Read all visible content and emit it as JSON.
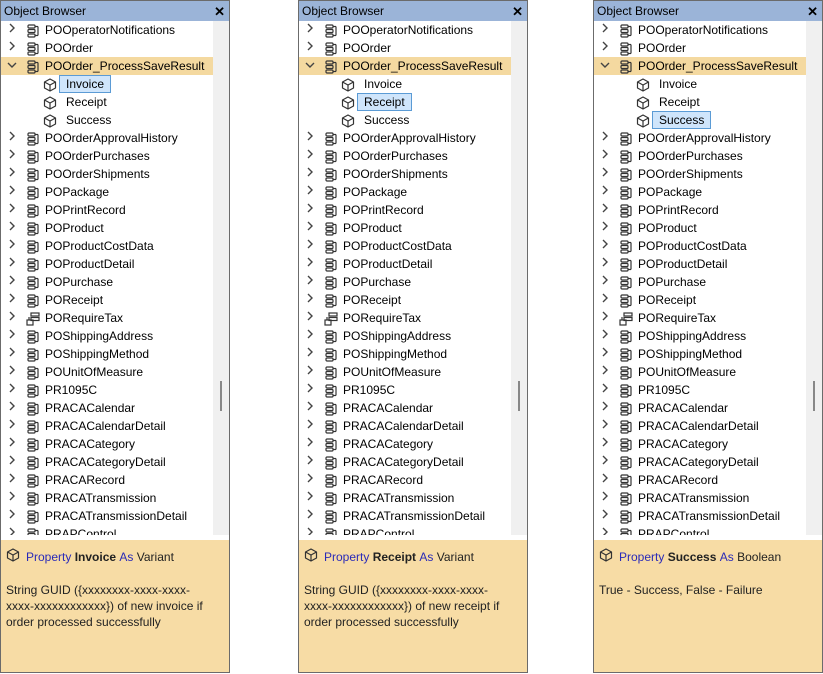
{
  "panels": [
    {
      "title": "Object Browser",
      "items": [
        {
          "type": "top",
          "label": "POOperatorNotifications",
          "icon": "table-icon",
          "chev": ">"
        },
        {
          "type": "top",
          "label": "POOrder",
          "icon": "table-icon",
          "chev": ">"
        },
        {
          "type": "top",
          "label": "POOrder_ProcessSaveResult",
          "icon": "table-icon",
          "chev": "v",
          "selected": true
        },
        {
          "type": "child",
          "label": "Invoice",
          "icon": "cube-icon",
          "hl": true
        },
        {
          "type": "child",
          "label": "Receipt",
          "icon": "cube-icon"
        },
        {
          "type": "child",
          "label": "Success",
          "icon": "cube-icon"
        },
        {
          "type": "top",
          "label": "POOrderApprovalHistory",
          "icon": "table-icon",
          "chev": ">"
        },
        {
          "type": "top",
          "label": "POOrderPurchases",
          "icon": "table-icon",
          "chev": ">"
        },
        {
          "type": "top",
          "label": "POOrderShipments",
          "icon": "table-icon",
          "chev": ">"
        },
        {
          "type": "top",
          "label": "POPackage",
          "icon": "table-icon",
          "chev": ">"
        },
        {
          "type": "top",
          "label": "POPrintRecord",
          "icon": "table-icon",
          "chev": ">"
        },
        {
          "type": "top",
          "label": "POProduct",
          "icon": "table-icon",
          "chev": ">"
        },
        {
          "type": "top",
          "label": "POProductCostData",
          "icon": "table-icon",
          "chev": ">"
        },
        {
          "type": "top",
          "label": "POProductDetail",
          "icon": "table-icon",
          "chev": ">"
        },
        {
          "type": "top",
          "label": "POPurchase",
          "icon": "table-icon",
          "chev": ">"
        },
        {
          "type": "top",
          "label": "POReceipt",
          "icon": "table-icon",
          "chev": ">"
        },
        {
          "type": "top",
          "label": "PORequireTax",
          "icon": "link-table-icon",
          "chev": ">"
        },
        {
          "type": "top",
          "label": "POShippingAddress",
          "icon": "table-icon",
          "chev": ">"
        },
        {
          "type": "top",
          "label": "POShippingMethod",
          "icon": "table-icon",
          "chev": ">"
        },
        {
          "type": "top",
          "label": "POUnitOfMeasure",
          "icon": "table-icon",
          "chev": ">"
        },
        {
          "type": "top",
          "label": "PR1095C",
          "icon": "table-icon",
          "chev": ">"
        },
        {
          "type": "top",
          "label": "PRACACalendar",
          "icon": "table-icon",
          "chev": ">"
        },
        {
          "type": "top",
          "label": "PRACACalendarDetail",
          "icon": "table-icon",
          "chev": ">"
        },
        {
          "type": "top",
          "label": "PRACACategory",
          "icon": "table-icon",
          "chev": ">"
        },
        {
          "type": "top",
          "label": "PRACACategoryDetail",
          "icon": "table-icon",
          "chev": ">"
        },
        {
          "type": "top",
          "label": "PRACARecord",
          "icon": "table-icon",
          "chev": ">"
        },
        {
          "type": "top",
          "label": "PRACATransmission",
          "icon": "table-icon",
          "chev": ">"
        },
        {
          "type": "top",
          "label": "PRACATransmissionDetail",
          "icon": "table-icon",
          "chev": ">"
        },
        {
          "type": "top",
          "label": "PRAPControl",
          "icon": "table-icon",
          "chev": ">"
        }
      ],
      "desc": {
        "kw1": "Property",
        "name": "Invoice",
        "kw2": "As",
        "type": "Variant",
        "body": "String GUID ({xxxxxxxx-xxxx-xxxx-xxxx-xxxxxxxxxxxx}) of new invoice if order processed successfully"
      }
    },
    {
      "title": "Object Browser",
      "items": [
        {
          "type": "top",
          "label": "POOperatorNotifications",
          "icon": "table-icon",
          "chev": ">"
        },
        {
          "type": "top",
          "label": "POOrder",
          "icon": "table-icon",
          "chev": ">"
        },
        {
          "type": "top",
          "label": "POOrder_ProcessSaveResult",
          "icon": "table-icon",
          "chev": "v",
          "selected": true
        },
        {
          "type": "child",
          "label": "Invoice",
          "icon": "cube-icon"
        },
        {
          "type": "child",
          "label": "Receipt",
          "icon": "cube-icon",
          "hl": true
        },
        {
          "type": "child",
          "label": "Success",
          "icon": "cube-icon"
        },
        {
          "type": "top",
          "label": "POOrderApprovalHistory",
          "icon": "table-icon",
          "chev": ">"
        },
        {
          "type": "top",
          "label": "POOrderPurchases",
          "icon": "table-icon",
          "chev": ">"
        },
        {
          "type": "top",
          "label": "POOrderShipments",
          "icon": "table-icon",
          "chev": ">"
        },
        {
          "type": "top",
          "label": "POPackage",
          "icon": "table-icon",
          "chev": ">"
        },
        {
          "type": "top",
          "label": "POPrintRecord",
          "icon": "table-icon",
          "chev": ">"
        },
        {
          "type": "top",
          "label": "POProduct",
          "icon": "table-icon",
          "chev": ">"
        },
        {
          "type": "top",
          "label": "POProductCostData",
          "icon": "table-icon",
          "chev": ">"
        },
        {
          "type": "top",
          "label": "POProductDetail",
          "icon": "table-icon",
          "chev": ">"
        },
        {
          "type": "top",
          "label": "POPurchase",
          "icon": "table-icon",
          "chev": ">"
        },
        {
          "type": "top",
          "label": "POReceipt",
          "icon": "table-icon",
          "chev": ">"
        },
        {
          "type": "top",
          "label": "PORequireTax",
          "icon": "link-table-icon",
          "chev": ">"
        },
        {
          "type": "top",
          "label": "POShippingAddress",
          "icon": "table-icon",
          "chev": ">"
        },
        {
          "type": "top",
          "label": "POShippingMethod",
          "icon": "table-icon",
          "chev": ">"
        },
        {
          "type": "top",
          "label": "POUnitOfMeasure",
          "icon": "table-icon",
          "chev": ">"
        },
        {
          "type": "top",
          "label": "PR1095C",
          "icon": "table-icon",
          "chev": ">"
        },
        {
          "type": "top",
          "label": "PRACACalendar",
          "icon": "table-icon",
          "chev": ">"
        },
        {
          "type": "top",
          "label": "PRACACalendarDetail",
          "icon": "table-icon",
          "chev": ">"
        },
        {
          "type": "top",
          "label": "PRACACategory",
          "icon": "table-icon",
          "chev": ">"
        },
        {
          "type": "top",
          "label": "PRACACategoryDetail",
          "icon": "table-icon",
          "chev": ">"
        },
        {
          "type": "top",
          "label": "PRACARecord",
          "icon": "table-icon",
          "chev": ">"
        },
        {
          "type": "top",
          "label": "PRACATransmission",
          "icon": "table-icon",
          "chev": ">"
        },
        {
          "type": "top",
          "label": "PRACATransmissionDetail",
          "icon": "table-icon",
          "chev": ">"
        },
        {
          "type": "top",
          "label": "PRAPControl",
          "icon": "table-icon",
          "chev": ">"
        }
      ],
      "desc": {
        "kw1": "Property",
        "name": "Receipt",
        "kw2": "As",
        "type": "Variant",
        "body": "String GUID ({xxxxxxxx-xxxx-xxxx-xxxx-xxxxxxxxxxxx}) of new receipt if order processed successfully"
      }
    },
    {
      "title": "Object Browser",
      "items": [
        {
          "type": "top",
          "label": "POOperatorNotifications",
          "icon": "table-icon",
          "chev": ">"
        },
        {
          "type": "top",
          "label": "POOrder",
          "icon": "table-icon",
          "chev": ">"
        },
        {
          "type": "top",
          "label": "POOrder_ProcessSaveResult",
          "icon": "table-icon",
          "chev": "v",
          "selected": true
        },
        {
          "type": "child",
          "label": "Invoice",
          "icon": "cube-icon"
        },
        {
          "type": "child",
          "label": "Receipt",
          "icon": "cube-icon"
        },
        {
          "type": "child",
          "label": "Success",
          "icon": "cube-icon",
          "hl": true
        },
        {
          "type": "top",
          "label": "POOrderApprovalHistory",
          "icon": "table-icon",
          "chev": ">"
        },
        {
          "type": "top",
          "label": "POOrderPurchases",
          "icon": "table-icon",
          "chev": ">"
        },
        {
          "type": "top",
          "label": "POOrderShipments",
          "icon": "table-icon",
          "chev": ">"
        },
        {
          "type": "top",
          "label": "POPackage",
          "icon": "table-icon",
          "chev": ">"
        },
        {
          "type": "top",
          "label": "POPrintRecord",
          "icon": "table-icon",
          "chev": ">"
        },
        {
          "type": "top",
          "label": "POProduct",
          "icon": "table-icon",
          "chev": ">"
        },
        {
          "type": "top",
          "label": "POProductCostData",
          "icon": "table-icon",
          "chev": ">"
        },
        {
          "type": "top",
          "label": "POProductDetail",
          "icon": "table-icon",
          "chev": ">"
        },
        {
          "type": "top",
          "label": "POPurchase",
          "icon": "table-icon",
          "chev": ">"
        },
        {
          "type": "top",
          "label": "POReceipt",
          "icon": "table-icon",
          "chev": ">"
        },
        {
          "type": "top",
          "label": "PORequireTax",
          "icon": "link-table-icon",
          "chev": ">"
        },
        {
          "type": "top",
          "label": "POShippingAddress",
          "icon": "table-icon",
          "chev": ">"
        },
        {
          "type": "top",
          "label": "POShippingMethod",
          "icon": "table-icon",
          "chev": ">"
        },
        {
          "type": "top",
          "label": "POUnitOfMeasure",
          "icon": "table-icon",
          "chev": ">"
        },
        {
          "type": "top",
          "label": "PR1095C",
          "icon": "table-icon",
          "chev": ">"
        },
        {
          "type": "top",
          "label": "PRACACalendar",
          "icon": "table-icon",
          "chev": ">"
        },
        {
          "type": "top",
          "label": "PRACACalendarDetail",
          "icon": "table-icon",
          "chev": ">"
        },
        {
          "type": "top",
          "label": "PRACACategory",
          "icon": "table-icon",
          "chev": ">"
        },
        {
          "type": "top",
          "label": "PRACACategoryDetail",
          "icon": "table-icon",
          "chev": ">"
        },
        {
          "type": "top",
          "label": "PRACARecord",
          "icon": "table-icon",
          "chev": ">"
        },
        {
          "type": "top",
          "label": "PRACATransmission",
          "icon": "table-icon",
          "chev": ">"
        },
        {
          "type": "top",
          "label": "PRACATransmissionDetail",
          "icon": "table-icon",
          "chev": ">"
        },
        {
          "type": "top",
          "label": "PRAPControl",
          "icon": "table-icon",
          "chev": ">"
        }
      ],
      "desc": {
        "kw1": "Property",
        "name": "Success",
        "kw2": "As",
        "type": "Boolean",
        "body": "True - Success, False - Failure"
      }
    }
  ],
  "colors": {
    "titlebar": "#9bb4d8",
    "selected": "#f4d9a0",
    "highlight": "#cfe5fb",
    "desc_bg": "#f7dca5",
    "keyword": "#2a2ab8"
  }
}
